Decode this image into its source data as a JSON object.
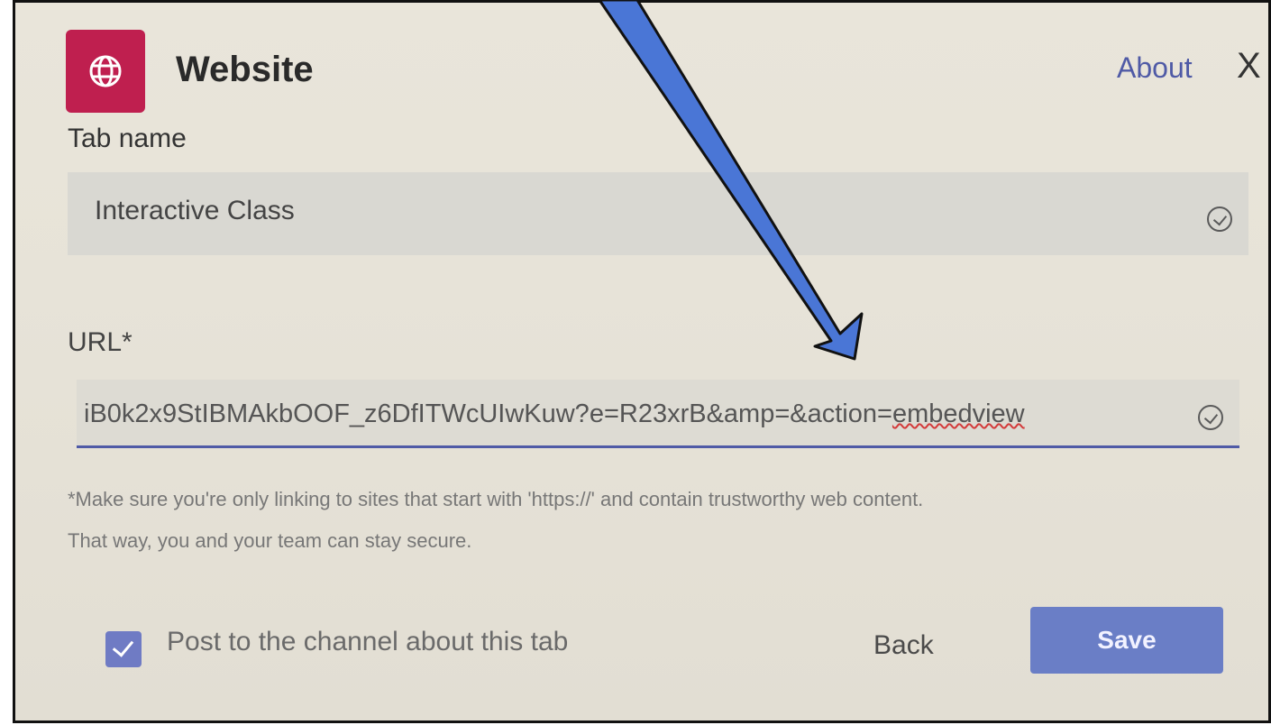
{
  "dialog": {
    "app_icon": "globe-icon",
    "title": "Website",
    "about_link": "About",
    "close_label": "X",
    "close_icon": "close-icon",
    "accent_color": "#4f5aa6",
    "brand_color": "#bf1f4f"
  },
  "tab_name": {
    "label": "Tab name",
    "value": "Interactive Class",
    "status_icon": "check-circle-icon"
  },
  "url": {
    "label": "URL*",
    "value_main": "iB0k2x9StIBMAkbOOF_z6DfITWcUIwKuw?e=R23xrB&amp=&action=",
    "value_misspelled": "embedview",
    "status_icon": "check-circle-icon"
  },
  "note": {
    "line1": "*Make sure you're only linking to sites that start with 'https://' and contain trustworthy web content.",
    "line2": "That way, you and your team can stay secure."
  },
  "footer": {
    "post_checkbox_checked": true,
    "post_label": "Post to the channel about this tab",
    "back_label": "Back",
    "save_label": "Save",
    "save_color": "#6a7ec6"
  },
  "annotation": {
    "arrow_color": "#4a76d6",
    "arrow_icon": "arrow-annotation"
  }
}
